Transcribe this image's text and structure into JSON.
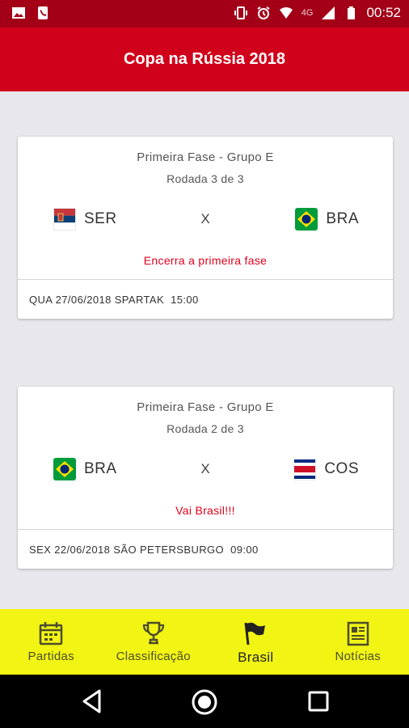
{
  "status_bar": {
    "time": "00:52",
    "network": "4G"
  },
  "app_bar": {
    "title": "Copa na Rússia 2018"
  },
  "matches": [
    {
      "phase": "Primeira Fase - Grupo E",
      "round": "Rodada 3 de 3",
      "home_team": "SER",
      "home_flag": "serbia-flag",
      "versus": "X",
      "away_team": "BRA",
      "away_flag": "brazil-flag",
      "note": "Encerra a primeira fase",
      "info": "QUA 27/06/2018 SPARTAK  15:00"
    },
    {
      "phase": "Primeira Fase - Grupo E",
      "round": "Rodada 2 de 3",
      "home_team": "BRA",
      "home_flag": "brazil-flag",
      "versus": "X",
      "away_team": "COS",
      "away_flag": "costa-rica-flag",
      "note": "Vai Brasil!!!",
      "info": "SEX 22/06/2018 SÃO PETERSBURGO  09:00"
    }
  ],
  "bottom_nav": {
    "items": [
      {
        "label": "Partidas",
        "icon": "calendar-icon"
      },
      {
        "label": "Classificação",
        "icon": "trophy-icon"
      },
      {
        "label": "Brasil",
        "icon": "flag-icon",
        "active": true
      },
      {
        "label": "Notícias",
        "icon": "newspaper-icon"
      }
    ]
  },
  "colors": {
    "status_bar": "#a30018",
    "app_bar": "#d0021b",
    "background": "#e8e8ec",
    "bottom_nav": "#f2f514",
    "note_text": "#e0001b"
  }
}
